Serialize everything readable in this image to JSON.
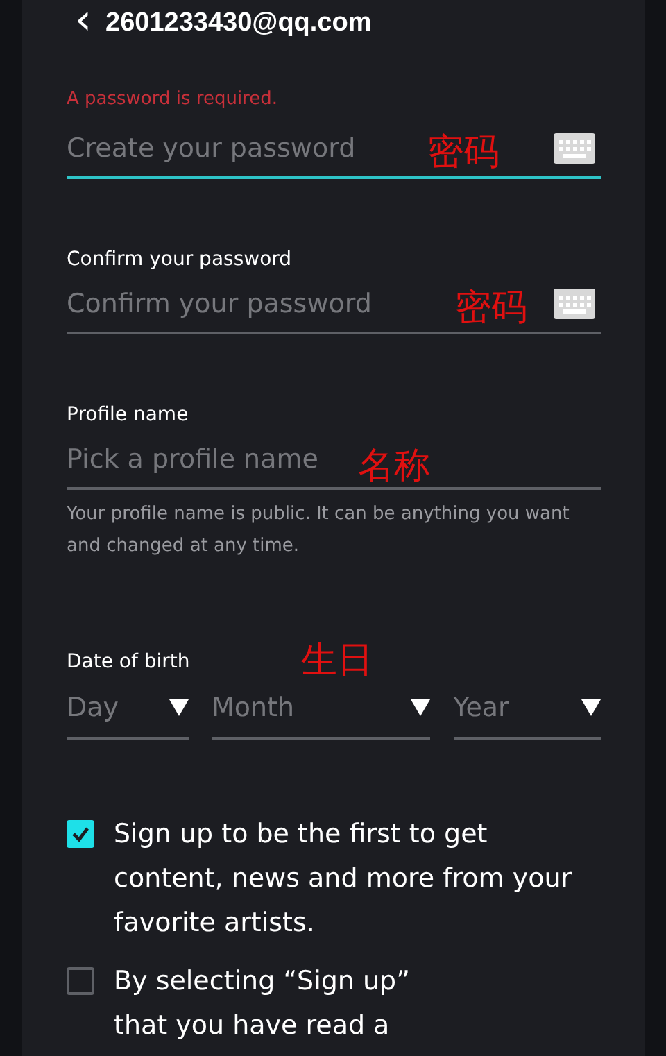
{
  "header": {
    "back_icon": "‹",
    "title": "2601233430@qq.com"
  },
  "fields": [
    {
      "error": "A password is required.",
      "placeholder": "Create your password",
      "focused": true,
      "keyboard_icon": true,
      "annotation": "密码"
    },
    {
      "label": "Confirm your password",
      "placeholder": "Confirm your password",
      "focused": false,
      "keyboard_icon": true,
      "annotation": "密码"
    },
    {
      "label": "Profile name",
      "placeholder": "Pick a profile name",
      "focused": false,
      "keyboard_icon": false,
      "annotation": "名称",
      "help": "Your profile name is public. It can be anything you want and changed at any time."
    }
  ],
  "date_of_birth": {
    "label": "Date of birth",
    "annotation": "生日",
    "selects": [
      {
        "placeholder": "Day"
      },
      {
        "placeholder": "Month"
      },
      {
        "placeholder": "Year"
      }
    ]
  },
  "checkboxes": [
    {
      "text": "Sign up to be the first to get content, news and more from your favorite artists.",
      "checked": true
    },
    {
      "text": "By selecting “Sign up”\nthat you have read a",
      "checked": false
    }
  ]
}
